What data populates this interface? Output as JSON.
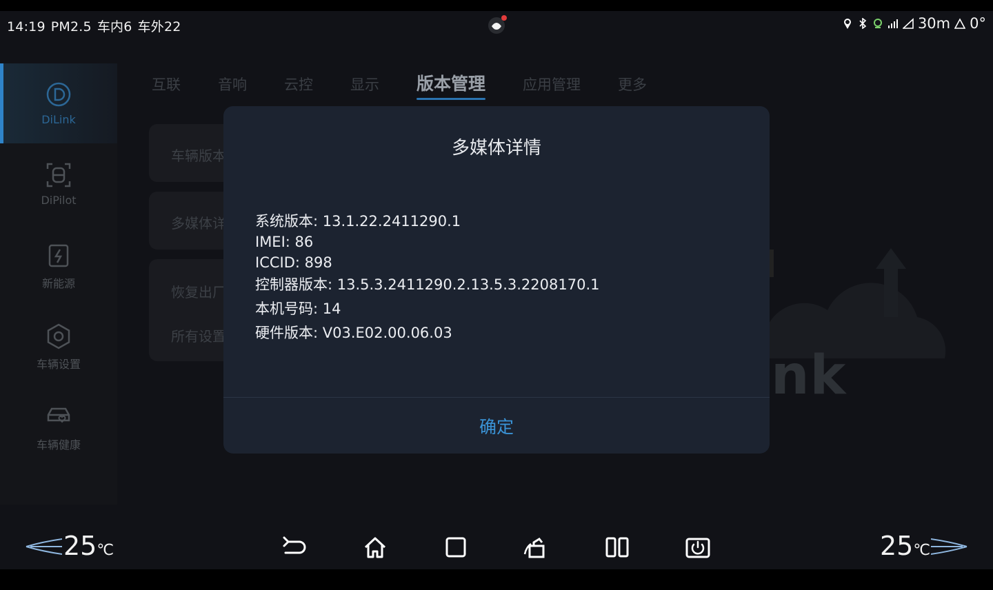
{
  "status_bar": {
    "time": "14:19",
    "pm25": "PM2.5",
    "inside": "车内6",
    "outside": "车外22",
    "distance": "30m",
    "angle": "0°"
  },
  "sidebar": {
    "items": [
      {
        "label": "DiLink",
        "icon": "dilink-icon"
      },
      {
        "label": "DiPilot",
        "icon": "camera-frame-icon"
      },
      {
        "label": "新能源",
        "icon": "battery-icon"
      },
      {
        "label": "车辆设置",
        "icon": "hexagon-settings-icon"
      },
      {
        "label": "车辆健康",
        "icon": "car-heart-icon"
      }
    ]
  },
  "tabs": [
    "互联",
    "音响",
    "云控",
    "显示",
    "版本管理",
    "应用管理",
    "更多"
  ],
  "background_cards": [
    "车辆版本",
    "多媒体详情",
    "恢复出厂",
    "所有设置"
  ],
  "background_logo": "nk",
  "dialog": {
    "title": "多媒体详情",
    "lines": [
      "系统版本: 13.1.22.2411290.1",
      "IMEI: 86",
      "ICCID: 898",
      "控制器版本: 13.5.3.2411290.2.13.5.3.2208170.1",
      "本机号码: 14",
      "硬件版本: V03.E02.00.06.03"
    ],
    "confirm_label": "确定"
  },
  "bottom_bar": {
    "left_temp": "25",
    "right_temp": "25",
    "temp_unit": "℃"
  },
  "colors": {
    "accent": "#3a93d6",
    "dialog_bg": "#1c2330",
    "screen_bg": "#111217"
  }
}
